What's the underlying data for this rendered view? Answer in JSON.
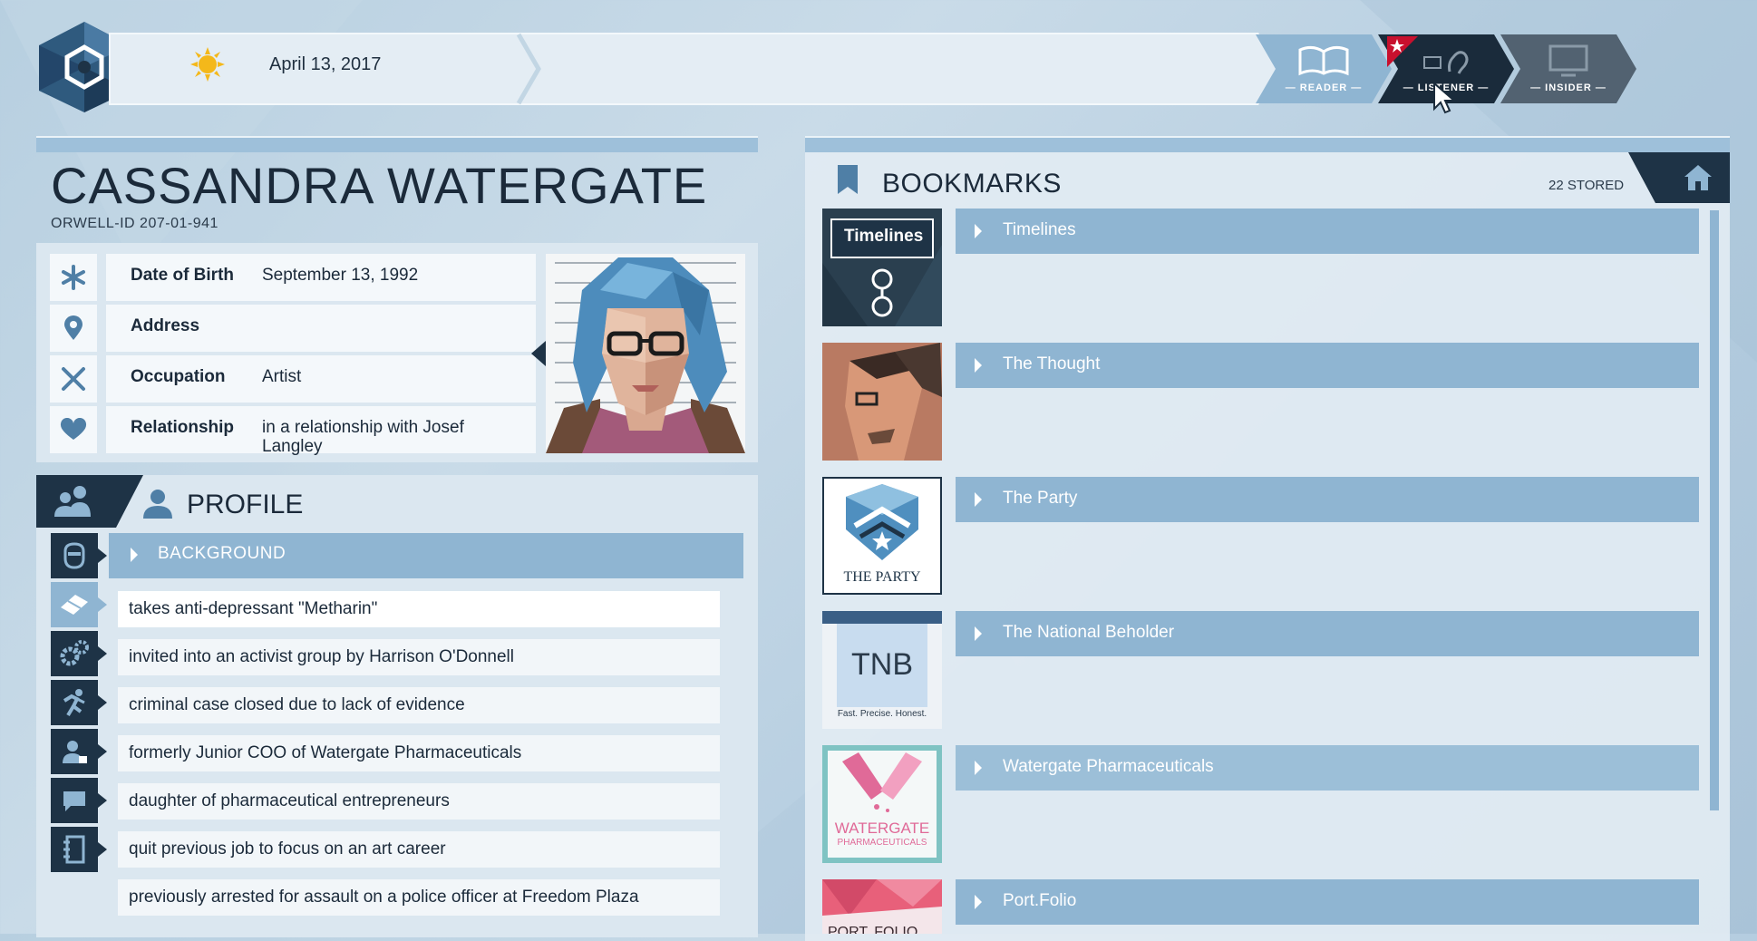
{
  "header": {
    "date": "April 13, 2017",
    "modes": [
      {
        "label": "— READER —",
        "icon": "book-icon"
      },
      {
        "label": "— LISTENER —",
        "icon": "ear-icon"
      },
      {
        "label": "— INSIDER —",
        "icon": "monitor-icon"
      }
    ]
  },
  "person": {
    "name": "CASSANDRA WATERGATE",
    "orwell_id": "ORWELL-ID  207-01-941",
    "fields": [
      {
        "label": "Date of Birth",
        "value": "September 13, 1992",
        "icon": "asterisk-icon"
      },
      {
        "label": "Address",
        "value": "",
        "icon": "location-pin-icon"
      },
      {
        "label": "Occupation",
        "value": "Artist",
        "icon": "tools-icon"
      },
      {
        "label": "Relationship",
        "value": "in a relationship with Josef Langley",
        "icon": "heart-icon"
      }
    ]
  },
  "profile": {
    "title": "PROFILE",
    "section_label": "BACKGROUND",
    "facts": [
      "takes anti-depressant \"Metharin\"",
      "invited into an activist group by Harrison O'Donnell",
      "criminal case closed due to lack of evidence",
      "formerly Junior COO of Watergate Pharmaceuticals",
      "daughter of pharmaceutical entrepreneurs",
      "quit previous job to focus on an art career",
      "previously arrested for assault on a police officer at Freedom Plaza"
    ],
    "side_icons": [
      "face-icon",
      "pill-icon",
      "gears-icon",
      "runner-icon",
      "person-badge-icon",
      "speech-icon",
      "notebook-icon"
    ]
  },
  "bookmarks": {
    "title": "BOOKMARKS",
    "stored": "22 STORED",
    "items": [
      {
        "label": "Timelines",
        "thumb_text": "Timelines"
      },
      {
        "label": "The Thought",
        "thumb_text": ""
      },
      {
        "label": "The Party",
        "thumb_text": "THE PARTY"
      },
      {
        "label": "The National Beholder",
        "thumb_text": "TNB",
        "thumb_sub": "Fast. Precise. Honest."
      },
      {
        "label": "Watergate Pharmaceuticals",
        "thumb_text": "WATERGATE",
        "thumb_sub": "PHARMACEUTICALS"
      },
      {
        "label": "Port.Folio",
        "thumb_text": "PORT. FOLIO"
      }
    ]
  },
  "colors": {
    "accent": "#8fb5d2",
    "dark": "#1e3346",
    "alert": "#c8102e"
  }
}
